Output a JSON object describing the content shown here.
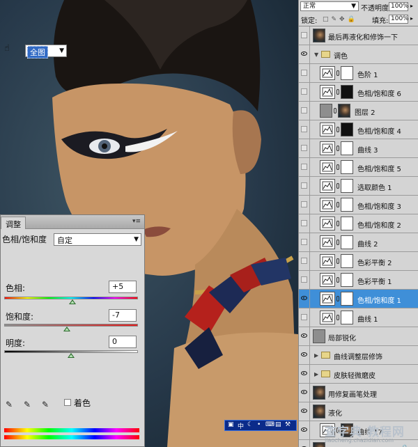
{
  "photo": {
    "alt": ""
  },
  "adjustments": {
    "tab_label": "调整",
    "title": "色相/饱和度",
    "preset_value": "自定",
    "channel_value": "全图",
    "hue_label": "色相:",
    "hue_value": "+5",
    "hue_fraction": 0.51,
    "saturation_label": "饱和度:",
    "saturation_value": "-7",
    "saturation_fraction": 0.47,
    "lightness_label": "明度:",
    "lightness_value": "0",
    "lightness_fraction": 0.5,
    "colorize_label": "着色"
  },
  "layers": {
    "blend_mode": "正常",
    "opacity_label": "不透明度:",
    "opacity_value": "100%",
    "lock_label": "锁定:",
    "fill_label": "填充:",
    "fill_value": "100%",
    "items": [
      {
        "name": "最后再液化和修饰一下",
        "kind": "photo",
        "visible": false
      },
      {
        "name": "调色",
        "kind": "folder-open",
        "visible": true
      },
      {
        "name": "色阶 1",
        "kind": "levels",
        "visible": false
      },
      {
        "name": "色相/饱和度 6",
        "kind": "hsl-mask-dark",
        "visible": false
      },
      {
        "name": "图层 2",
        "kind": "gray-photo",
        "visible": false
      },
      {
        "name": "色相/饱和度 4",
        "kind": "hsl-mask-dark",
        "visible": false
      },
      {
        "name": "曲线 3",
        "kind": "curves",
        "visible": false
      },
      {
        "name": "色相/饱和度 5",
        "kind": "hsl",
        "visible": false
      },
      {
        "name": "选取颜色 1",
        "kind": "selective",
        "visible": false
      },
      {
        "name": "色相/饱和度 3",
        "kind": "hsl",
        "visible": false
      },
      {
        "name": "色相/饱和度 2",
        "kind": "hsl",
        "visible": false
      },
      {
        "name": "曲线 2",
        "kind": "curves",
        "visible": false
      },
      {
        "name": "色彩平衡 2",
        "kind": "balance",
        "visible": false
      },
      {
        "name": "色彩平衡 1",
        "kind": "balance",
        "visible": false
      },
      {
        "name": "色相/饱和度 1",
        "kind": "hsl",
        "visible": true,
        "selected": true
      },
      {
        "name": "曲线 1",
        "kind": "curves",
        "visible": false
      },
      {
        "name": "局部锐化",
        "kind": "gray",
        "visible": true
      },
      {
        "name": "曲线调整层修饰",
        "kind": "folder",
        "visible": true
      },
      {
        "name": "皮肤轻微磨皮",
        "kind": "folder",
        "visible": true
      },
      {
        "name": "用修复画笔处理",
        "kind": "photo",
        "visible": true
      },
      {
        "name": "液化",
        "kind": "photo",
        "visible": true
      },
      {
        "name": "曲线 17",
        "kind": "curves-photo",
        "visible": true
      },
      {
        "name": "背景",
        "kind": "photo-locked",
        "visible": true
      }
    ]
  },
  "imebar": {
    "label": "中"
  },
  "watermark": {
    "big": "查字典 教程网",
    "small": "jiaocheng.chazidian.com"
  }
}
